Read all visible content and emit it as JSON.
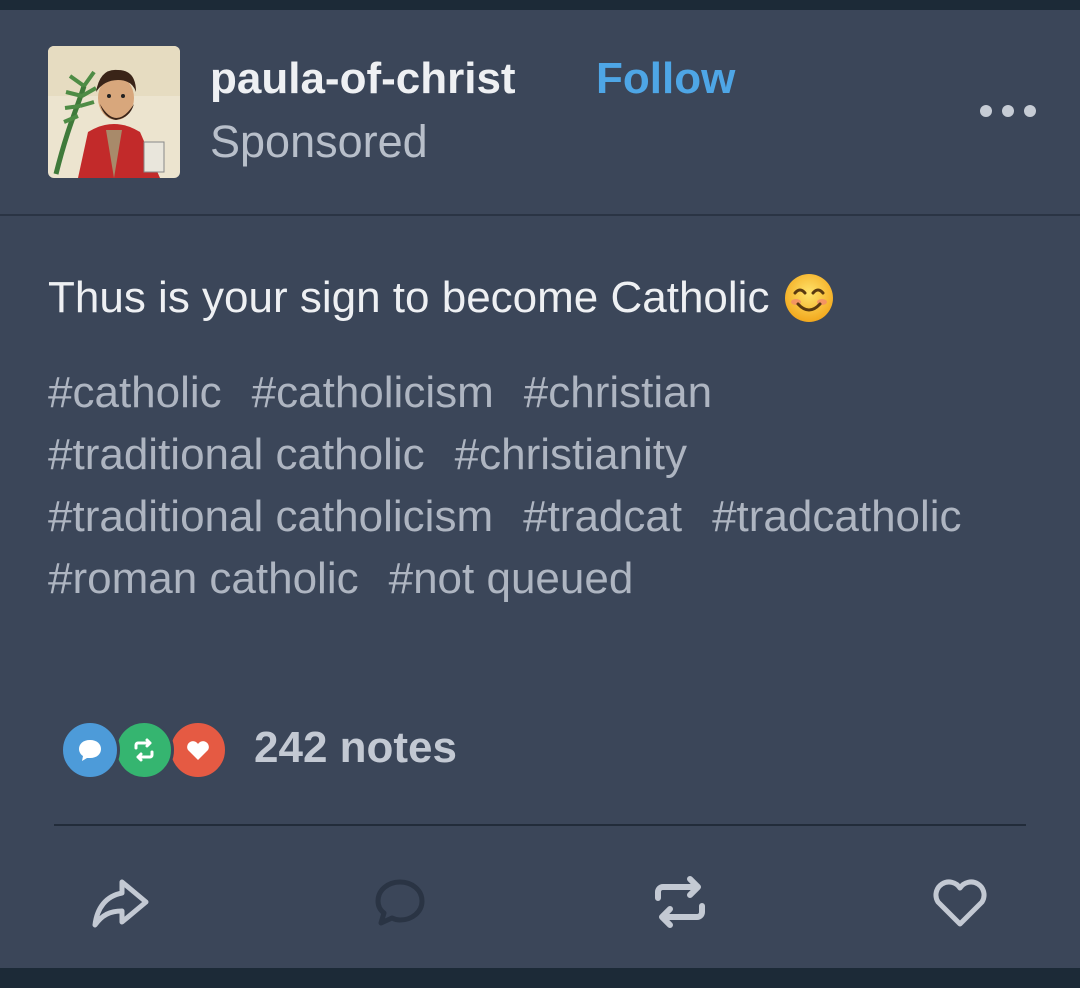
{
  "post": {
    "username": "paula-of-christ",
    "follow_label": "Follow",
    "sponsored_label": "Sponsored",
    "text": "Thus is your sign to become Catholic",
    "emoji": "smiling-face-emoji",
    "tags": [
      "#catholic",
      "#catholicism",
      "#christian",
      "#traditional catholic",
      "#christianity",
      "#traditional catholicism",
      "#tradcat",
      "#tradcatholic",
      "#roman catholic",
      "#not queued"
    ],
    "notes_label": "242 notes"
  },
  "icons": {
    "more": "more-options-icon",
    "note_types": [
      "comment-icon",
      "reblog-icon",
      "heart-icon"
    ],
    "actions": [
      "share-icon",
      "reply-icon",
      "reblog-icon",
      "like-icon"
    ]
  },
  "colors": {
    "card_bg": "#3b4659",
    "follow": "#4ea6e6",
    "comment_badge": "#4d9bd9",
    "reblog_badge": "#35b570",
    "like_badge": "#e55a43"
  }
}
